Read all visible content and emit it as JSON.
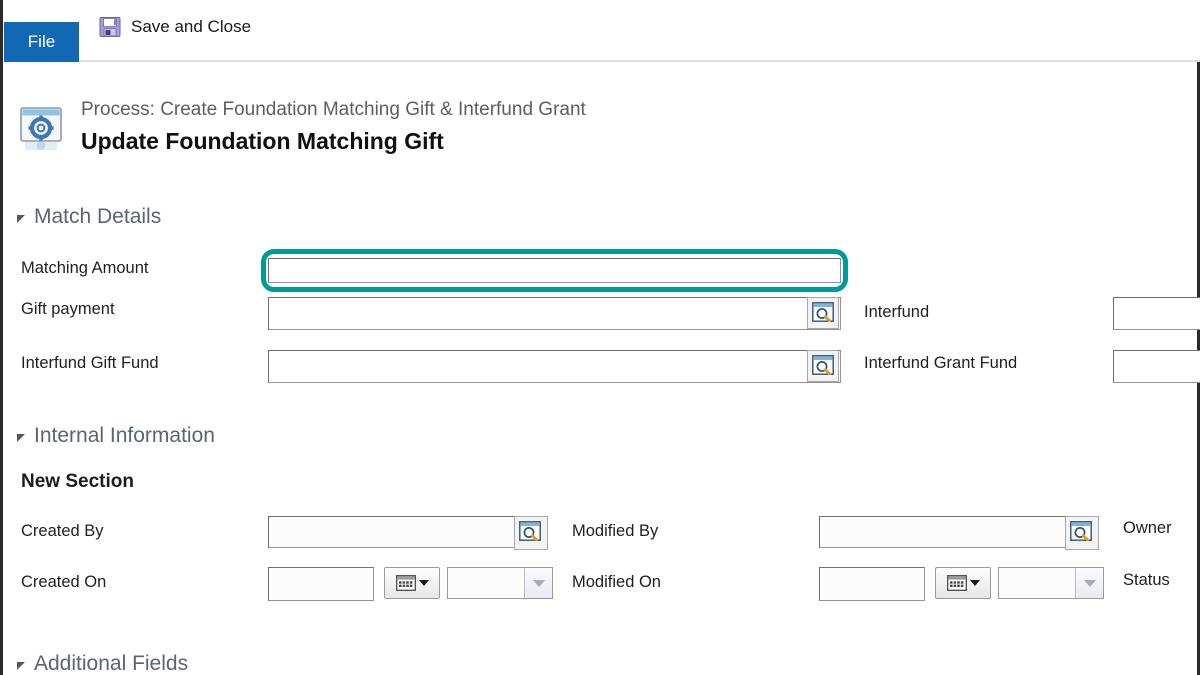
{
  "ribbon": {
    "file_tab": "File",
    "save_and_close": "Save and Close",
    "save_icon": "floppy-disk-save-icon"
  },
  "form_header": {
    "process_line": "Process: Create Foundation Matching Gift & Interfund Grant",
    "title": "Update Foundation Matching Gift",
    "icon": "process-gear-window-icon"
  },
  "sections": [
    {
      "title": "Match Details",
      "expanded": true
    },
    {
      "title": "Internal Information",
      "expanded": true
    },
    {
      "title": "Additional Fields",
      "expanded": true
    }
  ],
  "internal_subsection": "New Section",
  "match_details": {
    "matching_amount": {
      "label": "Matching Amount",
      "value": "",
      "highlighted": true
    },
    "gift_payment": {
      "label": "Gift payment",
      "value": "",
      "lookup_icon": "lookup-magnifier-icon"
    },
    "interfund": {
      "label": "Interfund",
      "value": ""
    },
    "interfund_gift_fund": {
      "label": "Interfund Gift Fund",
      "value": "",
      "lookup_icon": "lookup-magnifier-icon"
    },
    "interfund_grant_fund": {
      "label": "Interfund Grant Fund",
      "value": ""
    }
  },
  "internal_information": {
    "created_by": {
      "label": "Created By",
      "value": "",
      "lookup_icon": "lookup-magnifier-icon"
    },
    "modified_by": {
      "label": "Modified By",
      "value": "",
      "lookup_icon": "lookup-magnifier-icon"
    },
    "owner": {
      "label": "Owner",
      "value": ""
    },
    "created_on": {
      "label": "Created On",
      "date_value": "",
      "time_value": "",
      "calendar_icon": "calendar-icon"
    },
    "modified_on": {
      "label": "Modified On",
      "date_value": "",
      "time_value": "",
      "calendar_icon": "calendar-icon"
    },
    "status": {
      "label": "Status",
      "value": ""
    }
  },
  "colors": {
    "file_tab_blue": "#1268b3",
    "highlight_teal": "#009a9a",
    "section_header": "#5a6472"
  }
}
